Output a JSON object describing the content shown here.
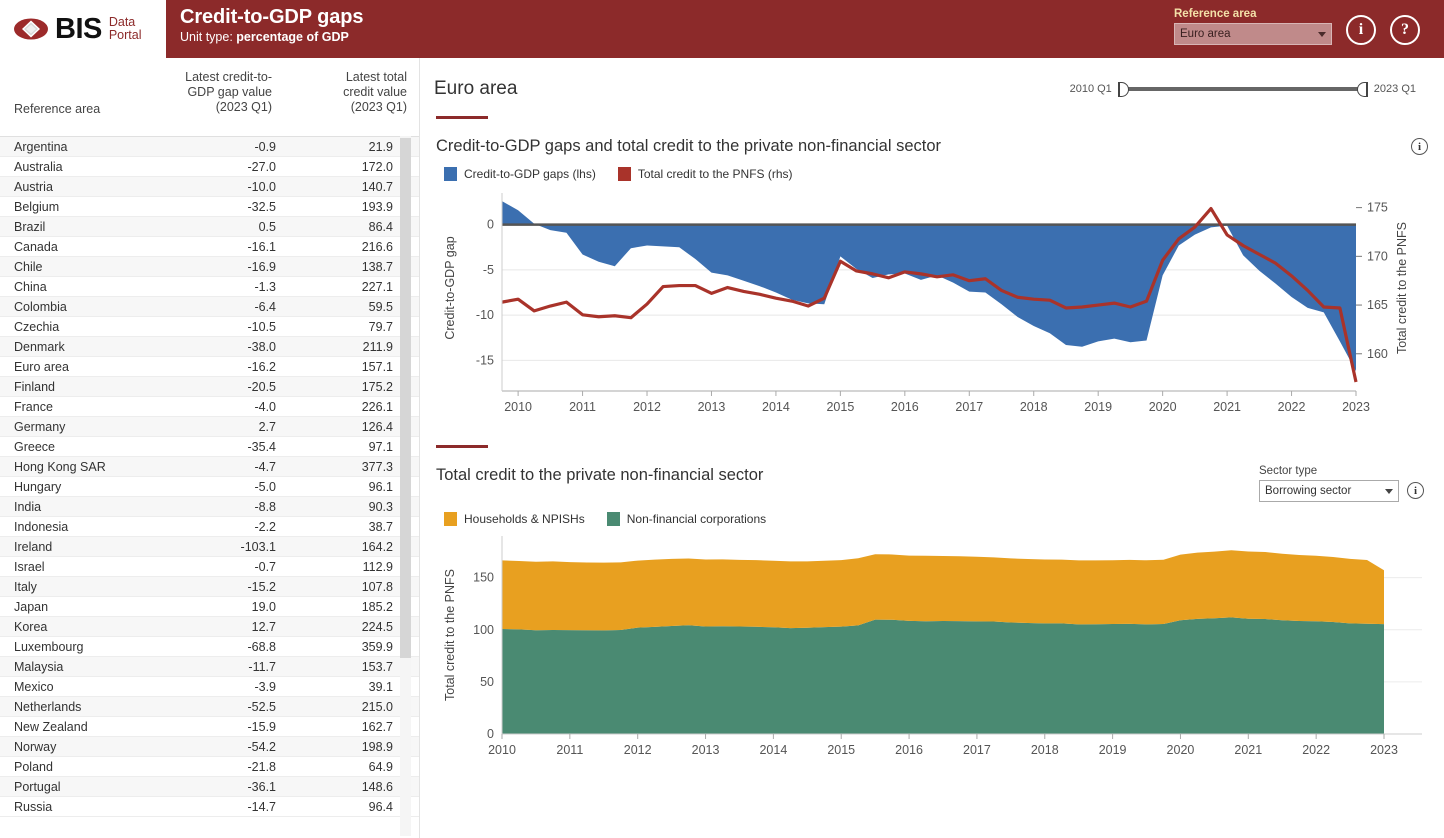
{
  "header": {
    "brand_main": "BIS",
    "brand_sub_line1": "Data",
    "brand_sub_line2": "Portal",
    "title": "Credit-to-GDP gaps",
    "unit_label": "Unit type:",
    "unit_value": "percentage of GDP",
    "reference_area_label": "Reference area",
    "reference_area_value": "Euro area",
    "info_button": "i",
    "help_button": "?",
    "bar_color": "#8c2a2a"
  },
  "table": {
    "columns": [
      "Reference area",
      "Latest credit-to-GDP gap value (2023 Q1)",
      "Latest total credit value (2023 Q1)"
    ],
    "col_gap_line1": "Latest credit-to-",
    "col_gap_line2": "GDP gap value",
    "col_gap_line3": "(2023 Q1)",
    "col_tot_line1": "Latest total",
    "col_tot_line2": "credit value",
    "col_tot_line3": "(2023 Q1)",
    "rows": [
      {
        "area": "Argentina",
        "gap": "-0.9",
        "total": "21.9"
      },
      {
        "area": "Australia",
        "gap": "-27.0",
        "total": "172.0"
      },
      {
        "area": "Austria",
        "gap": "-10.0",
        "total": "140.7"
      },
      {
        "area": "Belgium",
        "gap": "-32.5",
        "total": "193.9"
      },
      {
        "area": "Brazil",
        "gap": "0.5",
        "total": "86.4"
      },
      {
        "area": "Canada",
        "gap": "-16.1",
        "total": "216.6"
      },
      {
        "area": "Chile",
        "gap": "-16.9",
        "total": "138.7"
      },
      {
        "area": "China",
        "gap": "-1.3",
        "total": "227.1"
      },
      {
        "area": "Colombia",
        "gap": "-6.4",
        "total": "59.5"
      },
      {
        "area": "Czechia",
        "gap": "-10.5",
        "total": "79.7"
      },
      {
        "area": "Denmark",
        "gap": "-38.0",
        "total": "211.9"
      },
      {
        "area": "Euro area",
        "gap": "-16.2",
        "total": "157.1"
      },
      {
        "area": "Finland",
        "gap": "-20.5",
        "total": "175.2"
      },
      {
        "area": "France",
        "gap": "-4.0",
        "total": "226.1"
      },
      {
        "area": "Germany",
        "gap": "2.7",
        "total": "126.4"
      },
      {
        "area": "Greece",
        "gap": "-35.4",
        "total": "97.1"
      },
      {
        "area": "Hong Kong SAR",
        "gap": "-4.7",
        "total": "377.3"
      },
      {
        "area": "Hungary",
        "gap": "-5.0",
        "total": "96.1"
      },
      {
        "area": "India",
        "gap": "-8.8",
        "total": "90.3"
      },
      {
        "area": "Indonesia",
        "gap": "-2.2",
        "total": "38.7"
      },
      {
        "area": "Ireland",
        "gap": "-103.1",
        "total": "164.2"
      },
      {
        "area": "Israel",
        "gap": "-0.7",
        "total": "112.9"
      },
      {
        "area": "Italy",
        "gap": "-15.2",
        "total": "107.8"
      },
      {
        "area": "Japan",
        "gap": "19.0",
        "total": "185.2"
      },
      {
        "area": "Korea",
        "gap": "12.7",
        "total": "224.5"
      },
      {
        "area": "Luxembourg",
        "gap": "-68.8",
        "total": "359.9"
      },
      {
        "area": "Malaysia",
        "gap": "-11.7",
        "total": "153.7"
      },
      {
        "area": "Mexico",
        "gap": "-3.9",
        "total": "39.1"
      },
      {
        "area": "Netherlands",
        "gap": "-52.5",
        "total": "215.0"
      },
      {
        "area": "New Zealand",
        "gap": "-15.9",
        "total": "162.7"
      },
      {
        "area": "Norway",
        "gap": "-54.2",
        "total": "198.9"
      },
      {
        "area": "Poland",
        "gap": "-21.8",
        "total": "64.9"
      },
      {
        "area": "Portugal",
        "gap": "-36.1",
        "total": "148.6"
      },
      {
        "area": "Russia",
        "gap": "-14.7",
        "total": "96.4"
      }
    ]
  },
  "main": {
    "area_title": "Euro area",
    "slider_start": "2010 Q1",
    "slider_end": "2023 Q1"
  },
  "panel1": {
    "title": "Credit-to-GDP gaps and total credit to the private non-financial sector",
    "info_button": "i"
  },
  "panel2": {
    "title": "Total credit to the private non-financial sector",
    "sector_label": "Sector type",
    "sector_value": "Borrowing sector",
    "info_button": "i"
  },
  "chart_data": [
    {
      "type": "area",
      "title": "Credit-to-GDP gaps and total credit to the private non-financial sector",
      "xlabel": "",
      "ylabel": "Credit-to-GDP gap",
      "y2label": "Total credit to the PNFS",
      "ylim": [
        -17.5,
        3.5
      ],
      "y2lim": [
        157.0,
        176.5
      ],
      "yticks": [
        0,
        -5,
        -10,
        -15
      ],
      "y2ticks": [
        175,
        170,
        165,
        160
      ],
      "xticks": [
        "2010",
        "2011",
        "2012",
        "2013",
        "2014",
        "2015",
        "2016",
        "2017",
        "2018",
        "2019",
        "2020",
        "2021",
        "2022",
        "2023"
      ],
      "xlim": [
        "2009 Q4",
        "2023 Q1"
      ],
      "grid": true,
      "legend_position": "top-left",
      "series": [
        {
          "name": "Credit-to-GDP gaps (lhs)",
          "color": "#3b6fb0",
          "kind": "area-to-zero",
          "x": [
            "2009Q4",
            "2010Q1",
            "2010Q2",
            "2010Q3",
            "2010Q4",
            "2011Q1",
            "2011Q2",
            "2011Q3",
            "2011Q4",
            "2012Q1",
            "2012Q2",
            "2012Q3",
            "2012Q4",
            "2013Q1",
            "2013Q2",
            "2013Q3",
            "2013Q4",
            "2014Q1",
            "2014Q2",
            "2014Q3",
            "2014Q4",
            "2015Q1",
            "2015Q2",
            "2015Q3",
            "2015Q4",
            "2016Q1",
            "2016Q2",
            "2016Q3",
            "2016Q4",
            "2017Q1",
            "2017Q2",
            "2017Q3",
            "2017Q4",
            "2018Q1",
            "2018Q2",
            "2018Q3",
            "2018Q4",
            "2019Q1",
            "2019Q2",
            "2019Q3",
            "2019Q4",
            "2020Q1",
            "2020Q2",
            "2020Q3",
            "2020Q4",
            "2021Q1",
            "2021Q2",
            "2021Q3",
            "2021Q4",
            "2022Q1",
            "2022Q2",
            "2022Q3",
            "2022Q4",
            "2023Q1"
          ],
          "values": [
            2.6,
            1.6,
            0.1,
            -0.6,
            -0.9,
            -3.3,
            -4.1,
            -4.6,
            -2.6,
            -2.3,
            -2.4,
            -2.5,
            -3.8,
            -5.3,
            -5.6,
            -6.2,
            -6.8,
            -7.5,
            -8.3,
            -8.7,
            -8.8,
            -3.5,
            -4.9,
            -5.9,
            -5.5,
            -5.4,
            -6.1,
            -5.6,
            -6.4,
            -7.4,
            -7.5,
            -8.8,
            -10.2,
            -11.2,
            -12.0,
            -13.3,
            -13.5,
            -12.9,
            -12.6,
            -13.0,
            -12.8,
            -5.6,
            -2.3,
            -1.1,
            -0.3,
            -0.1,
            -3.4,
            -5.1,
            -6.5,
            -8.0,
            -9.2,
            -9.7,
            -12.9,
            -16.2
          ]
        },
        {
          "name": "Total credit to the PNFS (rhs)",
          "color": "#a9332a",
          "kind": "line",
          "x": [
            "2009Q4",
            "2010Q1",
            "2010Q2",
            "2010Q3",
            "2010Q4",
            "2011Q1",
            "2011Q2",
            "2011Q3",
            "2011Q4",
            "2012Q1",
            "2012Q2",
            "2012Q3",
            "2012Q4",
            "2013Q1",
            "2013Q2",
            "2013Q3",
            "2013Q4",
            "2014Q1",
            "2014Q2",
            "2014Q3",
            "2014Q4",
            "2015Q1",
            "2015Q2",
            "2015Q3",
            "2015Q4",
            "2016Q1",
            "2016Q2",
            "2016Q3",
            "2016Q4",
            "2017Q1",
            "2017Q2",
            "2017Q3",
            "2017Q4",
            "2018Q1",
            "2018Q2",
            "2018Q3",
            "2018Q4",
            "2019Q1",
            "2019Q2",
            "2019Q3",
            "2019Q4",
            "2020Q1",
            "2020Q2",
            "2020Q3",
            "2020Q4",
            "2021Q1",
            "2021Q2",
            "2021Q3",
            "2021Q4",
            "2022Q1",
            "2022Q2",
            "2022Q3",
            "2022Q4",
            "2023Q1"
          ],
          "values": [
            165.3,
            165.6,
            164.4,
            164.9,
            165.3,
            164.0,
            163.8,
            163.9,
            163.7,
            165.1,
            166.9,
            167.0,
            167.0,
            166.2,
            166.8,
            166.4,
            166.1,
            165.7,
            165.4,
            164.9,
            165.7,
            169.5,
            168.5,
            168.2,
            167.8,
            168.4,
            168.2,
            167.9,
            168.1,
            167.5,
            167.7,
            166.5,
            165.8,
            165.6,
            165.5,
            164.7,
            164.8,
            165.0,
            165.2,
            164.8,
            165.4,
            169.6,
            171.8,
            173.0,
            174.9,
            172.2,
            171.1,
            170.2,
            169.3,
            168.0,
            166.5,
            164.8,
            164.7,
            157.1
          ]
        }
      ]
    },
    {
      "type": "area",
      "title": "Total credit to the private non-financial sector",
      "xlabel": "",
      "ylabel": "Total credit to the PNFS",
      "ylim": [
        0,
        190
      ],
      "yticks": [
        0,
        50,
        100,
        150
      ],
      "xticks": [
        "2010",
        "2011",
        "2012",
        "2013",
        "2014",
        "2015",
        "2016",
        "2017",
        "2018",
        "2019",
        "2020",
        "2021",
        "2022",
        "2023"
      ],
      "stacked": true,
      "grid": true,
      "legend_position": "top-left",
      "x": [
        "2010Q1",
        "2010Q2",
        "2010Q3",
        "2010Q4",
        "2011Q1",
        "2011Q2",
        "2011Q3",
        "2011Q4",
        "2012Q1",
        "2012Q2",
        "2012Q3",
        "2012Q4",
        "2013Q1",
        "2013Q2",
        "2013Q3",
        "2013Q4",
        "2014Q1",
        "2014Q2",
        "2014Q3",
        "2014Q4",
        "2015Q1",
        "2015Q2",
        "2015Q3",
        "2015Q4",
        "2016Q1",
        "2016Q2",
        "2016Q3",
        "2016Q4",
        "2017Q1",
        "2017Q2",
        "2017Q3",
        "2017Q4",
        "2018Q1",
        "2018Q2",
        "2018Q3",
        "2018Q4",
        "2019Q1",
        "2019Q2",
        "2019Q3",
        "2019Q4",
        "2020Q1",
        "2020Q2",
        "2020Q3",
        "2020Q4",
        "2021Q1",
        "2021Q2",
        "2021Q3",
        "2021Q4",
        "2022Q1",
        "2022Q2",
        "2022Q3",
        "2022Q4",
        "2023Q1"
      ],
      "series": [
        {
          "name": "Non-financial corporations",
          "color": "#4a8a72",
          "values": [
            100.8,
            100.4,
            99.6,
            99.8,
            99.7,
            99.5,
            99.4,
            99.8,
            102.1,
            102.8,
            103.6,
            104.3,
            103.1,
            103.4,
            103.1,
            102.9,
            102.4,
            101.6,
            102.0,
            102.6,
            103.0,
            104.2,
            109.7,
            109.6,
            108.6,
            108.2,
            108.4,
            108.3,
            108.1,
            107.9,
            107.0,
            106.5,
            106.2,
            106.1,
            105.2,
            105.3,
            105.5,
            105.7,
            105.2,
            105.6,
            109.2,
            110.5,
            111.1,
            111.9,
            110.6,
            110.3,
            109.2,
            108.4,
            108.2,
            107.5,
            106.1,
            105.8,
            105.4
          ]
        },
        {
          "name": "Households & NPISHs",
          "color": "#e8a020",
          "values": [
            65.8,
            65.6,
            65.7,
            65.8,
            65.2,
            65.1,
            65.0,
            64.9,
            64.3,
            64.5,
            64.4,
            64.1,
            64.3,
            64.2,
            64.0,
            63.9,
            63.8,
            64.0,
            63.7,
            63.6,
            63.8,
            64.4,
            62.8,
            62.7,
            62.6,
            62.8,
            62.4,
            62.3,
            62.0,
            61.6,
            61.5,
            61.4,
            61.3,
            61.2,
            61.4,
            61.3,
            61.2,
            61.4,
            61.5,
            61.6,
            62.9,
            63.5,
            63.9,
            64.4,
            64.5,
            64.3,
            63.8,
            63.4,
            62.8,
            62.3,
            61.9,
            61.2,
            51.7
          ]
        }
      ]
    }
  ],
  "legend1": [
    {
      "label": "Credit-to-GDP gaps (lhs)",
      "color": "#3b6fb0"
    },
    {
      "label": "Total credit to the PNFS (rhs)",
      "color": "#a9332a"
    }
  ],
  "legend2": [
    {
      "label": "Households & NPISHs",
      "color": "#e8a020"
    },
    {
      "label": "Non-financial corporations",
      "color": "#4a8a72"
    }
  ],
  "axes1": {
    "ylabel": "Credit-to-GDP gap",
    "y2label": "Total credit to the PNFS"
  },
  "axes2": {
    "ylabel": "Total credit to the PNFS"
  }
}
